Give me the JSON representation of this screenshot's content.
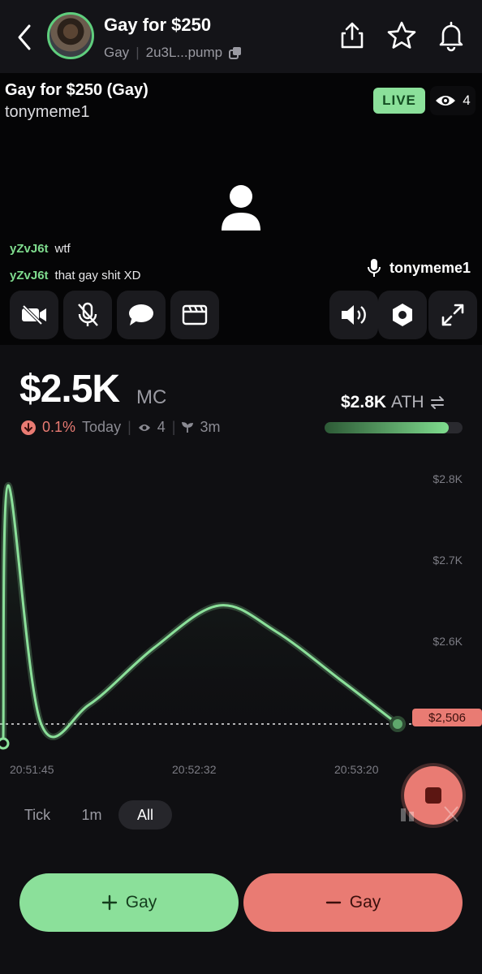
{
  "header": {
    "title": "Gay for $250",
    "ticker": "Gay",
    "address": "2u3L...pump"
  },
  "stream": {
    "title": "Gay for $250 (Gay)",
    "streamer": "tonymeme1",
    "live_label": "LIVE",
    "viewer_count": "4",
    "chat": [
      {
        "user": "yZvJ6t",
        "text": "wtf"
      },
      {
        "user": "yZvJ6t",
        "text": "that gay shit XD"
      }
    ],
    "speaker_name": "tonymeme1"
  },
  "market": {
    "market_cap": "$2.5K",
    "mc_unit": "MC",
    "change_pct": "0.1%",
    "change_period": "Today",
    "viewers": "4",
    "age": "3m",
    "ath_value": "$2.8K",
    "ath_label": "ATH",
    "ath_progress": 0.9
  },
  "chart_data": {
    "type": "line",
    "x_ticks": [
      "20:51:45",
      "20:52:32",
      "20:53:20"
    ],
    "y_ticks": [
      "$2.8K",
      "$2.7K",
      "$2.6K"
    ],
    "ylim": [
      2500,
      2800
    ],
    "current_price_label": "$2,506",
    "series": [
      {
        "values": [
          2488,
          2800,
          2508,
          2530,
          2600,
          2652,
          2620,
          2560,
          2506
        ]
      }
    ]
  },
  "intervals": {
    "tick": "Tick",
    "one_min": "1m",
    "all": "All",
    "selected": "All"
  },
  "trade": {
    "buy_label": "Gay",
    "sell_label": "Gay"
  },
  "colors": {
    "accent_green": "#8be09a",
    "accent_red": "#e97b73",
    "background": "#0f0f12"
  }
}
